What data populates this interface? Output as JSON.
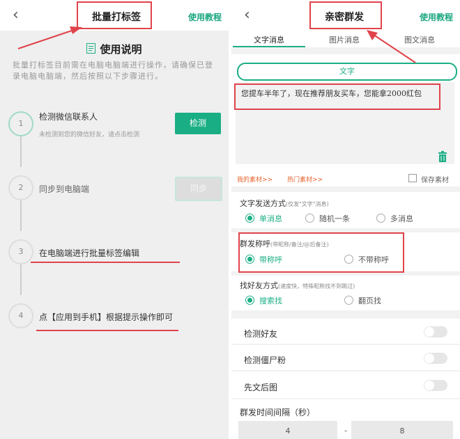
{
  "left": {
    "title": "批量打标签",
    "help": "使用教程",
    "instruction_title": "使用说明",
    "instruction_text": "批量打标签目前需在电脑电脑端进行操作，请确保已登录电脑电脑端，然后按照以下步骤进行。",
    "steps": [
      {
        "number": "1",
        "title": "检测微信联系人",
        "subtitle": "未检测到您的微信好友，请点击检测",
        "button": "检测"
      },
      {
        "number": "2",
        "title": "同步到电脑端",
        "button": "同步"
      },
      {
        "number": "3",
        "title": "在电脑端进行批量标签编辑"
      },
      {
        "number": "4",
        "title": "点【应用到手机】根据提示操作即可"
      }
    ]
  },
  "right": {
    "title": "亲密群发",
    "help": "使用教程",
    "tabs": [
      "文字消息",
      "图片消息",
      "图文消息"
    ],
    "text_pill": "文字",
    "message": "您提车半年了，现在推荐朋友买车，您能拿2000红包",
    "my_material": "我的素材>>",
    "hot_material": "热门素材>>",
    "save_material": "保存素材",
    "send_mode": {
      "title": "文字发送方式",
      "hint": "(仅发\"文字\"消息)",
      "options": [
        "单消息",
        "随机一条",
        "多消息"
      ],
      "selected": "单消息"
    },
    "greeting": {
      "title": "群发称呼",
      "hint": "(带昵称/备注/@后备注)",
      "options": [
        "带称呼",
        "不带称呼"
      ],
      "selected": "带称呼"
    },
    "find_friend": {
      "title": "找好友方式",
      "hint": "(速度快，特殊昵称找不到跳过)",
      "options": [
        "搜索找",
        "翻页找"
      ],
      "selected": "搜索找"
    },
    "toggles": [
      {
        "label": "检测好友",
        "on": false
      },
      {
        "label": "检测僵尸粉",
        "on": false
      },
      {
        "label": "先文后图",
        "on": false
      }
    ],
    "interval": {
      "title": "群发时间间隔（秒）",
      "min": "4",
      "max": "8"
    }
  },
  "colors": {
    "accent": "#1aae84",
    "highlight": "#e0434b",
    "link": "#e5632e"
  }
}
